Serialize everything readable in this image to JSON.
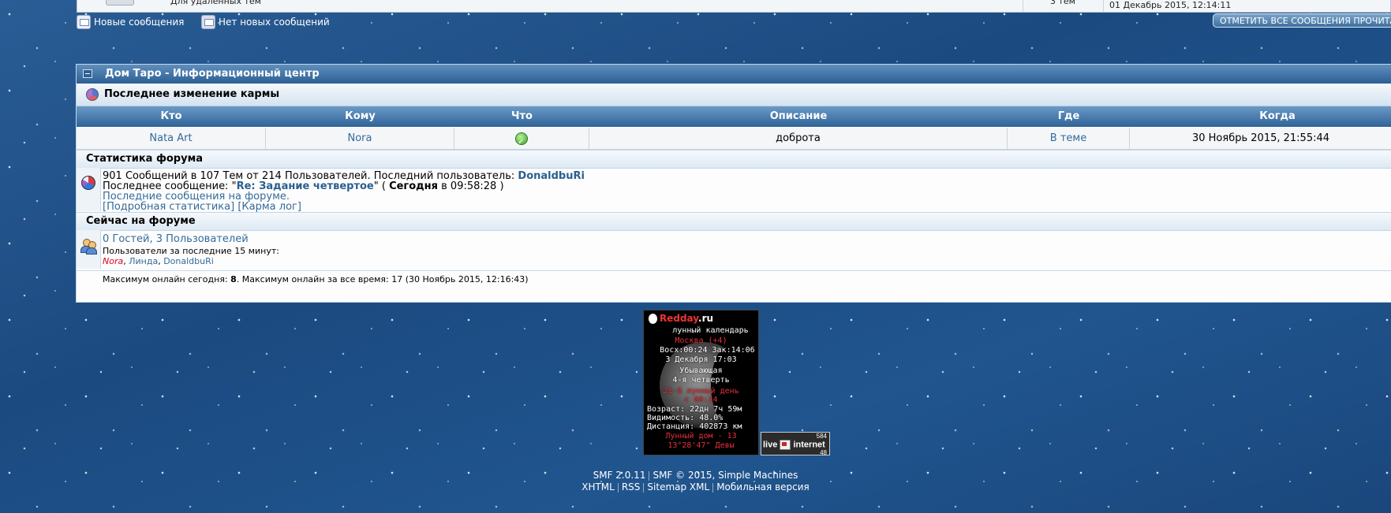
{
  "top": {
    "deleted_label": "Для удаленных тем",
    "count_label": "3 тем",
    "last_date": "01 Декабрь 2015, 12:14:11",
    "new_messages": "Новые сообщения",
    "no_new_messages": "Нет новых сообщений",
    "mark_read": "ОТМЕТИТЬ ВСЕ СООБЩЕНИЯ ПРОЧИТАННЫМИ"
  },
  "category": {
    "title": "Дом Таро - Информационный центр",
    "karma_title": "Последнее изменение кармы"
  },
  "karma_table": {
    "headers": [
      "Кто",
      "Кому",
      "Что",
      "Описание",
      "Где",
      "Когда"
    ],
    "row": {
      "who": "Nata Art",
      "whom": "Nora",
      "description": "доброта",
      "where": "В теме",
      "when": "30 Ноябрь 2015, 21:55:44"
    }
  },
  "stats": {
    "title": "Статистика форума",
    "line1_prefix": "901 Сообщений в 107 Тем от 214 Пользователей. Последний пользователь: ",
    "latest_member": "DonaldbuRi",
    "line2_prefix": "Последнее сообщение: \"",
    "last_post": "Re: Задание четвертое",
    "line2_mid": "\" ( ",
    "today": "Сегодня",
    "line2_suffix": " в 09:58:28 )",
    "recent_link": "Последние сообщения на форуме.",
    "detailed_link": "[Подробная статистика]",
    "karma_log_link": "[Карма лог]"
  },
  "online": {
    "title": "Сейчас на форуме",
    "guests_users": "0 Гостей, 3 Пользователей",
    "last15": "Пользователи за последние 15 минут:",
    "users": [
      "Nora",
      "Линда",
      "DonaldbuRi"
    ],
    "max_prefix": "Максимум онлайн сегодня: ",
    "max_today": "8",
    "max_suffix": ". Максимум онлайн за все время: 17 (30 Ноябрь 2015, 12:16:43)"
  },
  "moon_widget": {
    "logo_a": "Redday",
    "logo_b": ".ru",
    "subtitle": "лунный календарь",
    "city": "Москва (+4)",
    "rise_set": "Восх:00:24 Зак:14:06",
    "date": "3 Декабря 17:03",
    "phase1": "Убывающая",
    "phase2": "4-я четверть",
    "lunar_day": "21-й лунный день",
    "lunar_day_from": "с 00:24",
    "age": "Возраст: 22дн 7ч 59м",
    "visibility": "Видимость: 48.0%",
    "distance": "Дистанция: 402873 км",
    "lunar_house": "Лунный дом - 13",
    "degree": "13°28'47\" Девы"
  },
  "liveinternet": {
    "label_a": "live",
    "label_b": "internet",
    "count_top": "584",
    "count_bottom": "48"
  },
  "footer": {
    "smf": "SMF 2.0.11",
    "smf2": "SMF © 2015, Simple Machines",
    "xhtml": "XHTML",
    "rss": "RSS",
    "sitemap": "Sitemap XML",
    "mobile": "Мобильная версия"
  }
}
